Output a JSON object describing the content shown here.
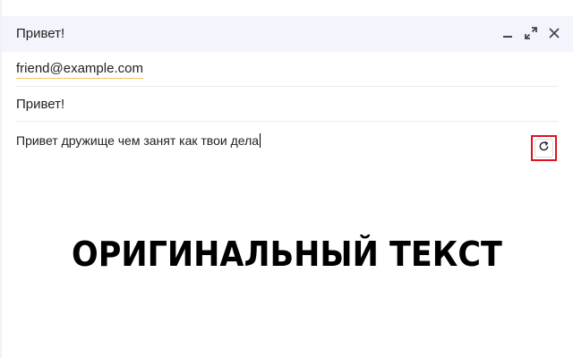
{
  "window": {
    "title": "Привет!",
    "controls": {
      "minimize_icon": "minimize-icon",
      "expand_icon": "expand-icon",
      "close_icon": "close-icon"
    }
  },
  "compose": {
    "to": "friend@example.com",
    "subject": "Привет!",
    "body": "Привет дружище чем занят как твои дела",
    "rewrite_icon": "refresh-icon"
  },
  "overlay": {
    "caption": "ОРИГИНАЛЬНЫЙ ТЕКСТ"
  },
  "colors": {
    "titlebar_bg": "#f2f6fc",
    "highlight_border": "#e0121f",
    "recipient_underline": "#f5c264",
    "caption_text": "#000000"
  }
}
